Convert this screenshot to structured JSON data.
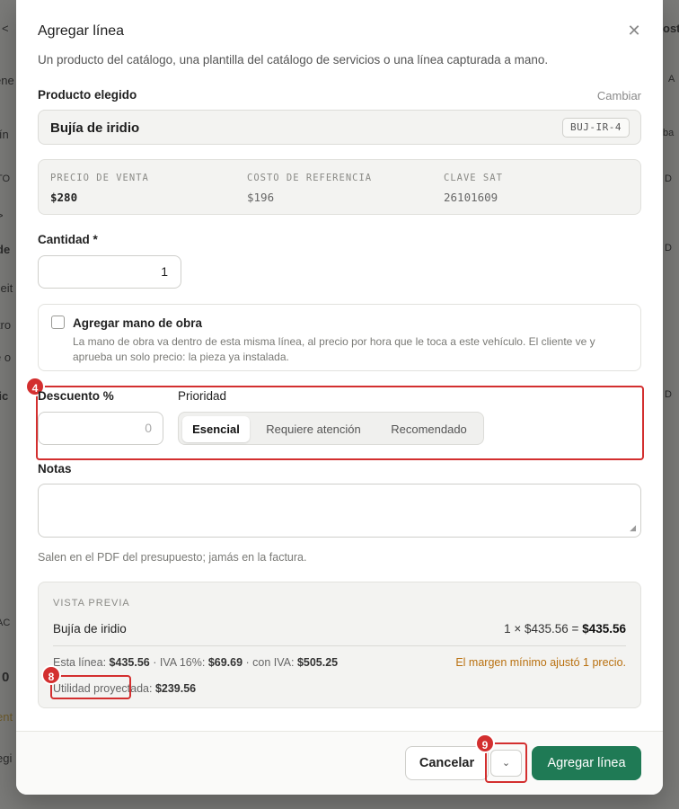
{
  "background": {
    "left_fragments": [
      "<",
      "ene",
      "lín",
      "TO",
      ">",
      "de",
      "ceit",
      "ltro",
      "e o",
      "tic",
      "AC",
      "0",
      "ent",
      "egi"
    ],
    "right_fragments": [
      "ost",
      "A",
      "ba",
      "D",
      "D",
      "D"
    ]
  },
  "modal": {
    "title": "Agregar línea",
    "subtitle": "Un producto del catálogo, una plantilla del catálogo de servicios o una línea capturada a mano."
  },
  "product": {
    "label": "Producto elegido",
    "change_link": "Cambiar",
    "name": "Bujía de iridio",
    "sku": "BUJ-IR-4"
  },
  "info": [
    {
      "label": "PRECIO DE VENTA",
      "value": "$280"
    },
    {
      "label": "COSTO DE REFERENCIA",
      "value": "$196"
    },
    {
      "label": "CLAVE SAT",
      "value": "26101609"
    }
  ],
  "quantity": {
    "label": "Cantidad *",
    "value": "1"
  },
  "labor": {
    "title": "Agregar mano de obra",
    "description": "La mano de obra va dentro de esta misma línea, al precio por hora que le toca a este vehículo. El cliente ve y aprueba un solo precio: la pieza ya instalada."
  },
  "discount": {
    "label": "Descuento %",
    "placeholder": "0"
  },
  "priority": {
    "label": "Prioridad",
    "options": [
      "Esencial",
      "Requiere atención",
      "Recomendado"
    ],
    "selected": "Esencial"
  },
  "notes": {
    "label": "Notas",
    "help": "Salen en el PDF del presupuesto; jamás en la factura."
  },
  "preview": {
    "heading": "VISTA PREVIA",
    "item": "Bujía de iridio",
    "calc_prefix": "1 × $435.56 = ",
    "calc_total": "$435.56",
    "line_label": "Esta línea: ",
    "line_value": "$435.56",
    "iva_label": " · IVA 16%: ",
    "iva_value": "$69.69",
    "with_iva_label": " · con IVA: ",
    "with_iva_value": "$505.25",
    "warning": "El margen mínimo ajustó 1 precio.",
    "utility_label": "Utilidad proyectada: ",
    "utility_value": "$239.56"
  },
  "footer": {
    "cancel": "Cancelar",
    "add": "Agregar línea"
  },
  "annotations": {
    "badge_4": "4",
    "badge_8": "8",
    "badge_9": "9"
  },
  "colors": {
    "primary": "#1f7a55",
    "highlight": "#d32f2f",
    "warning": "#b9700f"
  }
}
